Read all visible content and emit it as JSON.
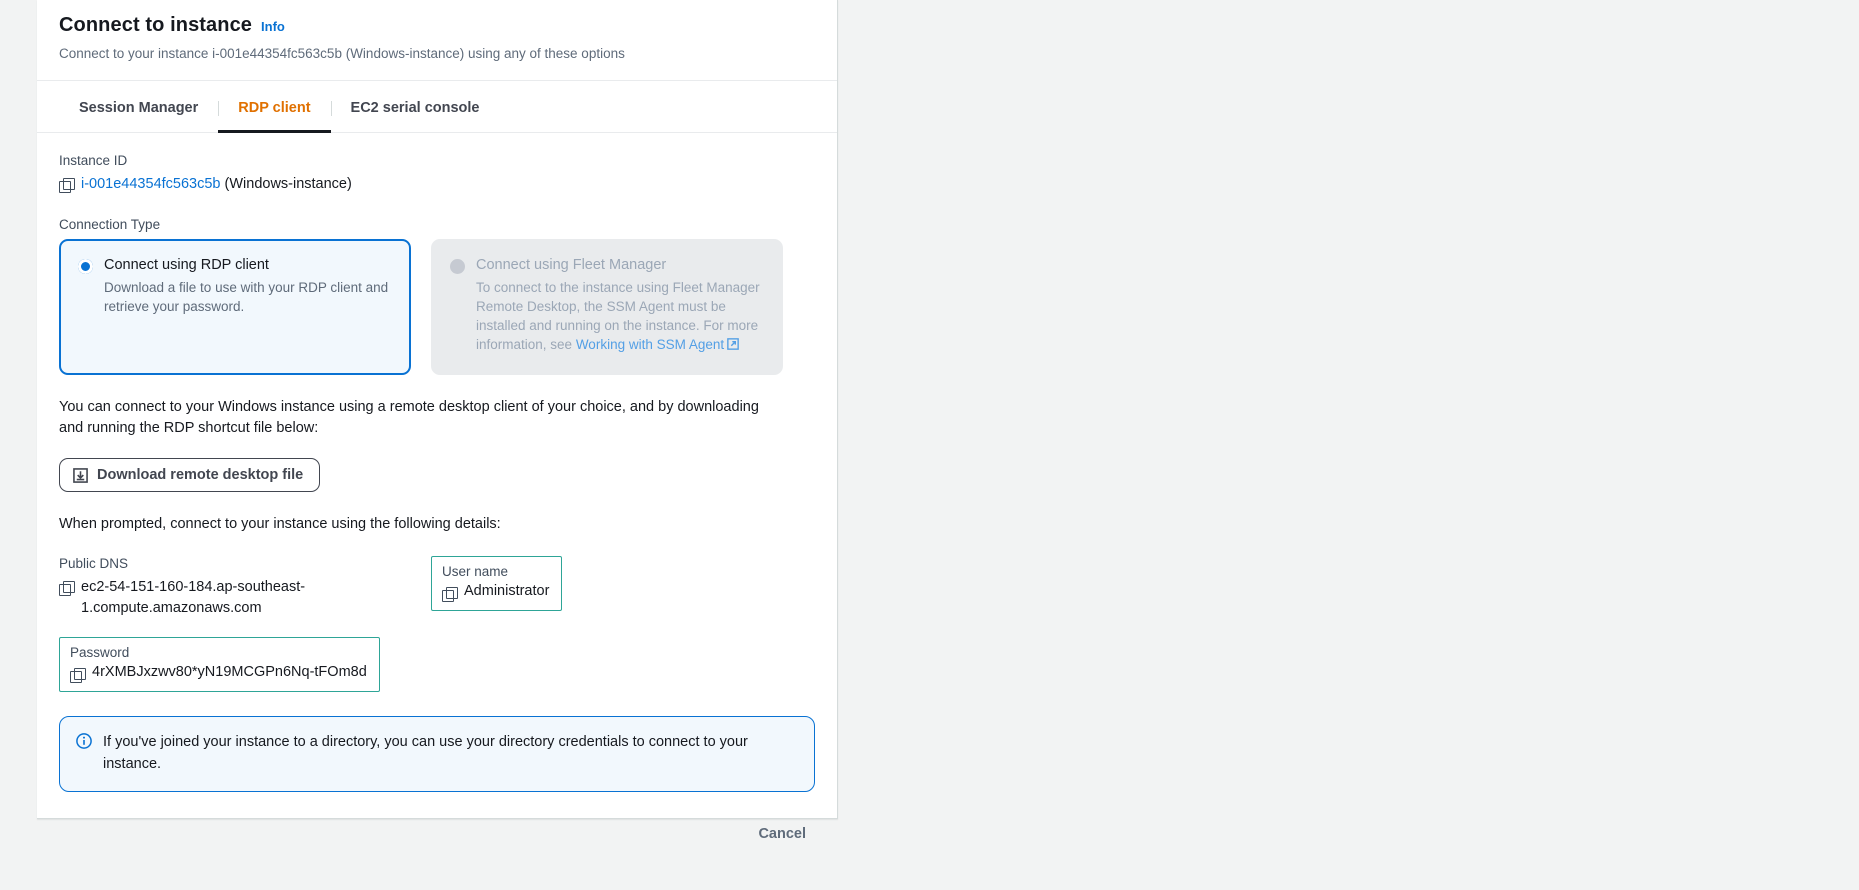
{
  "header": {
    "title": "Connect to instance",
    "info_label": "Info",
    "subtitle": "Connect to your instance i-001e44354fc563c5b (Windows-instance) using any of these options"
  },
  "tabs": [
    {
      "label": "Session Manager",
      "active": false
    },
    {
      "label": "RDP client",
      "active": true
    },
    {
      "label": "EC2 serial console",
      "active": false
    }
  ],
  "instance": {
    "label": "Instance ID",
    "id": "i-001e44354fc563c5b",
    "name_suffix": "(Windows-instance)",
    "copy_icon": "copy-icon"
  },
  "connection_type": {
    "label": "Connection Type",
    "options": [
      {
        "title": "Connect using RDP client",
        "description": "Download a file to use with your RDP client and retrieve your password.",
        "selected": true,
        "disabled": false
      },
      {
        "title": "Connect using Fleet Manager",
        "description_before": "To connect to the instance using Fleet Manager Remote Desktop, the SSM Agent must be installed and running on the instance. For more information, see ",
        "link_text": "Working with SSM Agent",
        "link_icon": "external-link-icon",
        "selected": false,
        "disabled": true
      }
    ]
  },
  "instructions": {
    "paragraph_1": "You can connect to your Windows instance using a remote desktop client of your choice, and by downloading and running the RDP shortcut file below:",
    "download_button": "Download remote desktop file",
    "download_icon": "download-icon",
    "paragraph_2": "When prompted, connect to your instance using the following details:"
  },
  "details": {
    "public_dns": {
      "label": "Public DNS",
      "value": "ec2-54-151-160-184.ap-southeast-1.compute.amazonaws.com"
    },
    "user_name": {
      "label": "User name",
      "value": "Administrator"
    },
    "password": {
      "label": "Password",
      "value": "4rXMBJxzwv80*yN19MCGPn6Nq-tFOm8d"
    }
  },
  "alert": {
    "icon": "info-circle-icon",
    "text": "If you've joined your instance to a directory, you can use your directory credentials to connect to your instance."
  },
  "footer": {
    "cancel_label": "Cancel"
  },
  "colors": {
    "accent_orange": "#e07000",
    "link_blue": "#0972d3",
    "highlight_teal": "#2ea597",
    "page_background": "#f2f3f3"
  }
}
